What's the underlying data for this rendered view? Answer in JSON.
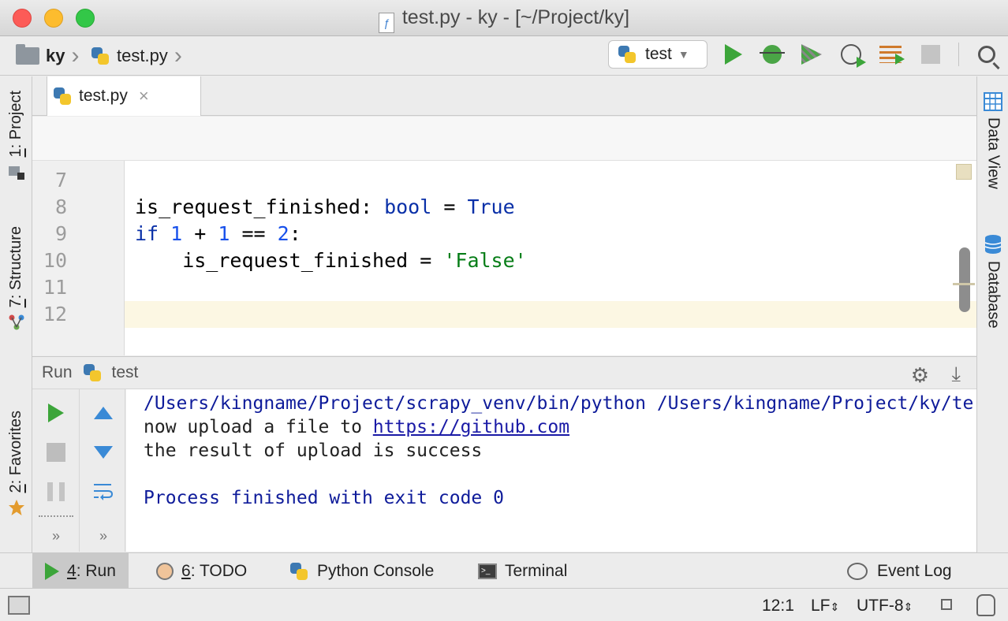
{
  "window": {
    "title": "test.py - ky - [~/Project/ky]"
  },
  "navbar": {
    "crumbs": [
      "ky",
      "test.py"
    ],
    "run_config": "test"
  },
  "left_strip": {
    "project": {
      "num": "1",
      "label": ": Project"
    },
    "structure": {
      "num": "7",
      "label": ": Structure"
    },
    "favorites": {
      "num": "2",
      "label": ": Favorites"
    }
  },
  "right_strip": {
    "data_view": "Data View",
    "database": "Database"
  },
  "editor": {
    "tab_label": "test.py",
    "tab_close": "×",
    "lines": [
      {
        "n": "7",
        "code": ""
      },
      {
        "n": "8",
        "code": "is_request_finished: bool = True"
      },
      {
        "n": "9",
        "code": "if 1 + 1 == 2:"
      },
      {
        "n": "10",
        "code": "    is_request_finished = 'False'"
      },
      {
        "n": "11",
        "code": ""
      },
      {
        "n": "12",
        "code": ""
      }
    ],
    "current_line": "12"
  },
  "run_panel": {
    "title": "Run",
    "config": "test",
    "output": [
      "/Users/kingname/Project/scrapy_venv/bin/python /Users/kingname/Project/ky/te",
      "now upload a file to ",
      "https://github.com",
      "the result of upload is success",
      "",
      "Process finished with exit code 0"
    ],
    "more_left": "»",
    "more_right": "»"
  },
  "bottom_tools": {
    "run": {
      "num": "4",
      "label": ": Run"
    },
    "todo": {
      "num": "6",
      "label": ": TODO"
    },
    "python_console": "Python Console",
    "terminal": "Terminal",
    "event_log": "Event Log"
  },
  "status": {
    "position": "12:1",
    "line_sep": "LF",
    "encoding": "UTF-8"
  },
  "colors": {
    "accent_run": "#3ca53a",
    "keyword": "#0a30a8",
    "number": "#1750eb",
    "string": "#067d17",
    "console_text": "#0e1b9a"
  }
}
